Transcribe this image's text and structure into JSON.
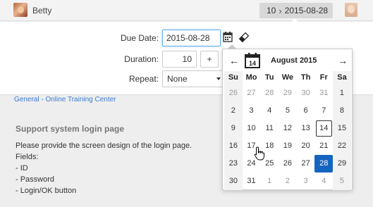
{
  "user": {
    "name": "Betty"
  },
  "breadcrumb": {
    "number": "10",
    "date": "2015-08-28"
  },
  "form": {
    "due_date_label": "Due Date:",
    "due_date_value": "2015-08-28",
    "duration_label": "Duration:",
    "duration_value": "10",
    "plus_label": "+",
    "repeat_label": "Repeat:",
    "repeat_value": "None"
  },
  "project_link": "General - Online Training Center",
  "task": {
    "title": "Support system login page",
    "description": [
      "Please provide the screen design of the login page.",
      "Fields:",
      "- ID",
      "- Password",
      "- Login/OK button"
    ]
  },
  "datepicker": {
    "icon_day": "14",
    "title": "August 2015",
    "weekdays": [
      "Su",
      "Mo",
      "Tu",
      "We",
      "Th",
      "Fr",
      "Sa"
    ],
    "weeks": [
      [
        "26",
        "27",
        "28",
        "29",
        "30",
        "31",
        "1"
      ],
      [
        "2",
        "3",
        "4",
        "5",
        "6",
        "7",
        "8"
      ],
      [
        "9",
        "10",
        "11",
        "12",
        "13",
        "14",
        "15"
      ],
      [
        "16",
        "17",
        "18",
        "19",
        "20",
        "21",
        "22"
      ],
      [
        "23",
        "24",
        "25",
        "26",
        "27",
        "28",
        "29"
      ],
      [
        "30",
        "31",
        "1",
        "2",
        "3",
        "4",
        "5"
      ]
    ],
    "today": "14",
    "selected": "28",
    "accent_color": "#1565c0"
  }
}
